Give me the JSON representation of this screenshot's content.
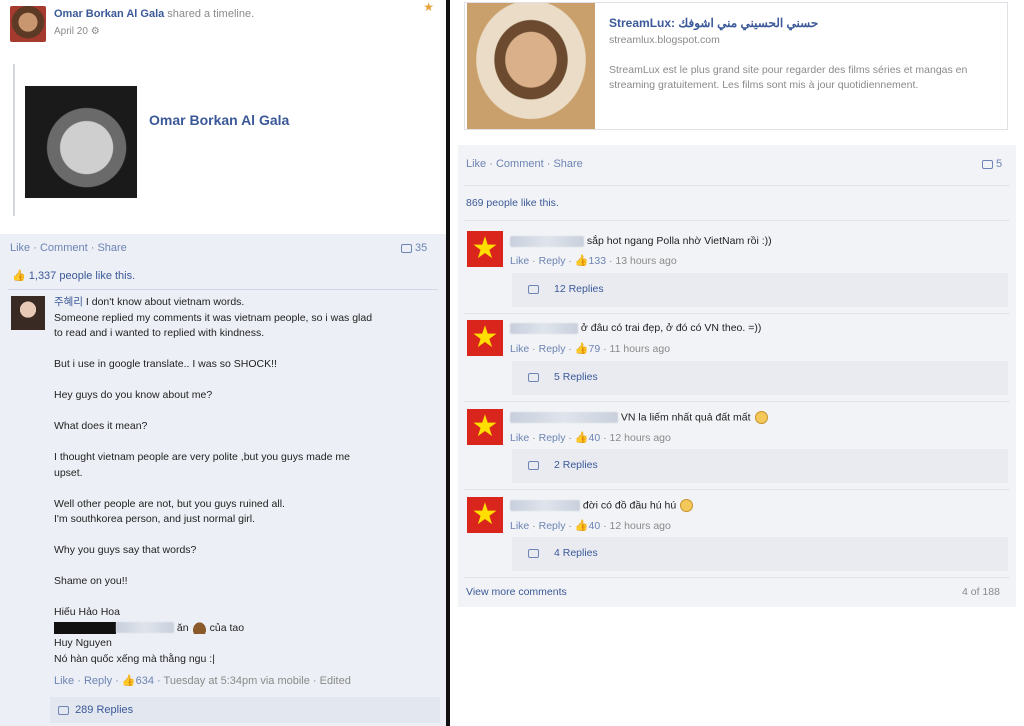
{
  "left": {
    "author": "Omar Borkan Al Gala",
    "shared_text": " shared a timeline.",
    "date": "April 20",
    "card_name": "Omar Borkan Al Gala",
    "actions": {
      "like": "Like",
      "comment": "Comment",
      "share": "Share"
    },
    "comment_count": "35",
    "likes_text": "1,337 people like this.",
    "comment": {
      "author": "주혜리",
      "lines": [
        "I don't know about vietnam words.",
        "Someone replied my comments it was vietnam people, so i was glad",
        "to read and i wanted to replied with kindness.",
        "",
        "But i use in google translate.. I was so SHOCK!!",
        "",
        "Hey guys do you know about me?",
        "",
        "What does it mean?",
        "",
        "I thought vietnam people are very polite ,but you guys made me",
        "upset.",
        "",
        "Well other people are not, but you guys ruined all.",
        "I'm southkorea person, and just normal girl.",
        "",
        "Why you guys say that words?",
        "",
        "Shame on you!!",
        "",
        "Hiếu Hảo Hoa"
      ],
      "redacted_suffix": "ăn",
      "redacted_tail": "của tao",
      "line_huy": "Huy Nguyen",
      "line_last": "Nó hàn quốc xếng mà thằng ngu :|",
      "foot_like": "Like",
      "foot_reply": "Reply",
      "foot_likes": "634",
      "foot_meta": "Tuesday at 5:34pm via mobile · Edited",
      "replies": "289 Replies"
    }
  },
  "right": {
    "share_title": "StreamLux: حسني الحسيني مني اشوفك",
    "share_url": "streamlux.blogspot.com",
    "share_desc": "StreamLux est le plus grand site pour regarder des films séries et mangas en streaming gratuitement. Les films sont mis à jour quotidiennement.",
    "actions": {
      "like": "Like",
      "comment": "Comment",
      "share": "Share"
    },
    "comment_count": "5",
    "likes_text": "869 people like this.",
    "comments": [
      {
        "text": "sắp hot ngang Polla nhờ VietNam rồi :))",
        "likes": "133",
        "time": "13 hours ago",
        "replies": "12 Replies"
      },
      {
        "text": "ở đâu có trai đẹp, ở đó có VN theo. =))",
        "likes": "79",
        "time": "11 hours ago",
        "replies": "5 Replies"
      },
      {
        "text": "VN la liếm nhất quả đất mất",
        "likes": "40",
        "time": "12 hours ago",
        "replies": "2 Replies"
      },
      {
        "text": "đời có đồ đầu hú hú",
        "likes": "40",
        "time": "12 hours ago",
        "replies": "4 Replies"
      }
    ],
    "reply_label": "Reply",
    "like_label": "Like",
    "view_more": "View more comments",
    "of_count": "4 of 188"
  }
}
